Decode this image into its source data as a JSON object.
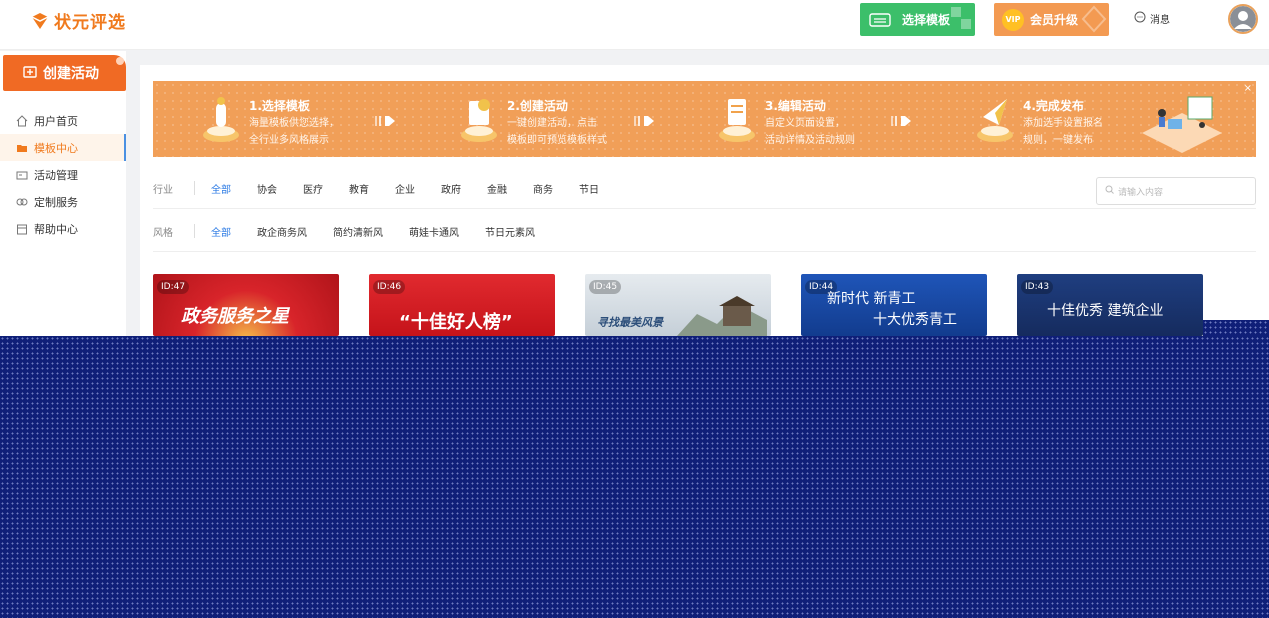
{
  "header": {
    "logo_text": "状元评选",
    "choose_template_label": "选择模板",
    "vip_badge": "VIP",
    "vip_label": "会员升级",
    "message_label": "消息"
  },
  "sidebar": {
    "create_label": "创建活动",
    "items": [
      {
        "label": "用户首页",
        "icon": "home-icon"
      },
      {
        "label": "模板中心",
        "icon": "folder-icon",
        "active": true
      },
      {
        "label": "活动管理",
        "icon": "id-card-icon"
      },
      {
        "label": "定制服务",
        "icon": "gift-icon"
      },
      {
        "label": "帮助中心",
        "icon": "calendar-icon"
      }
    ]
  },
  "banner": {
    "steps": [
      {
        "title": "1.选择模板",
        "desc1": "海量模板供您选择，",
        "desc2": "全行业多风格展示"
      },
      {
        "title": "2.创建活动",
        "desc1": "一键创建活动，点击",
        "desc2": "模板即可预览模板样式"
      },
      {
        "title": "3.编辑活动",
        "desc1": "自定义页面设置，",
        "desc2": "活动详情及活动规则"
      },
      {
        "title": "4.完成发布",
        "desc1": "添加选手设置报名",
        "desc2": "规则，一键发布"
      }
    ],
    "close": "×"
  },
  "filters": {
    "industry_label": "行业",
    "industry_options": [
      "全部",
      "协会",
      "医疗",
      "教育",
      "企业",
      "政府",
      "金融",
      "商务",
      "节日"
    ],
    "style_label": "风格",
    "style_options": [
      "全部",
      "政企商务风",
      "简约清新风",
      "萌娃卡通风",
      "节日元素风"
    ],
    "search_placeholder": "请输入内容"
  },
  "cards": [
    {
      "id": "ID:47",
      "title": "政务服务之星",
      "bg": "#c8161d"
    },
    {
      "id": "ID:46",
      "title": "“十佳好人榜”",
      "bg": "#d0171f"
    },
    {
      "id": "ID:45",
      "title": "寻找最美风景",
      "bg": "#c9d3dd"
    },
    {
      "id": "ID:44",
      "title1": "新时代 新青工",
      "title2": "十大优秀青工",
      "bg": "#1749a8"
    },
    {
      "id": "ID:43",
      "title": "十佳优秀 建筑企业",
      "bg": "#1b3a78"
    }
  ],
  "colors": {
    "brand_orange": "#f07a1e",
    "green": "#3cbf6a",
    "banner": "#f19f58",
    "link_blue": "#2b7ae4",
    "overlay": "#0f1f78"
  }
}
